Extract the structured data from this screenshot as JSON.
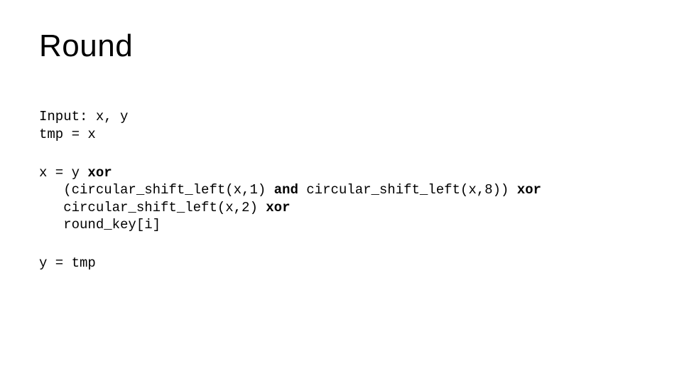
{
  "title": "Round",
  "kw": {
    "xor": "xor",
    "and": "and"
  },
  "code": {
    "l1": "Input: x, y",
    "l2": "tmp = x",
    "l3a": "x = y ",
    "l4a": "   (circular_shift_left(x,1) ",
    "l4b": " circular_shift_left(x,8)) ",
    "l5a": "   circular_shift_left(x,2) ",
    "l6": "   round_key[i]",
    "l7": "y = tmp"
  }
}
